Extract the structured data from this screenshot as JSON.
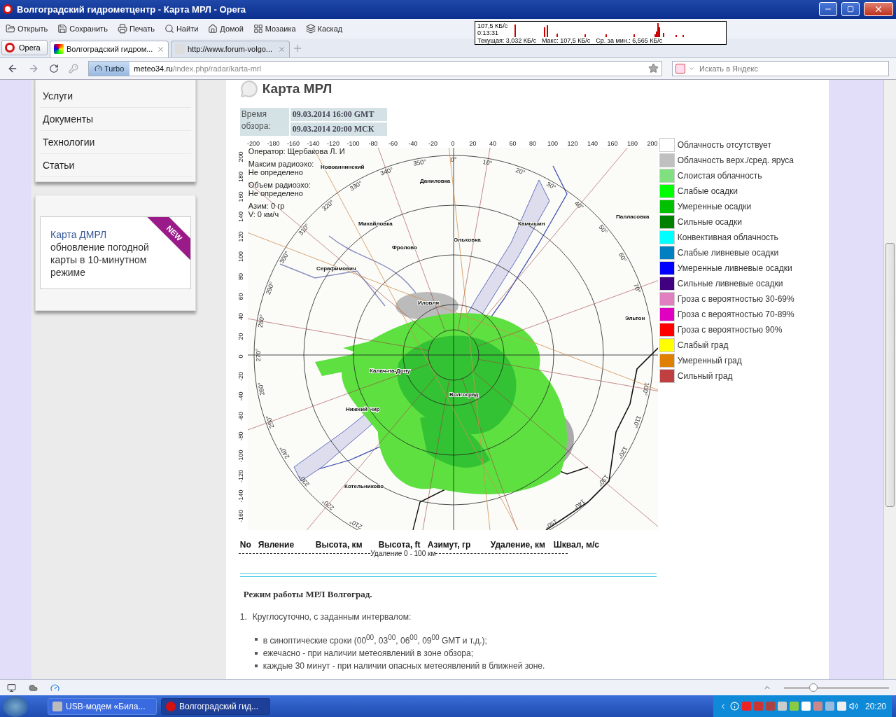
{
  "window": {
    "title": "Волгоградский гидрометцентр - Карта МРЛ - Opera"
  },
  "toolbar": [
    {
      "label": "Открыть"
    },
    {
      "label": "Сохранить"
    },
    {
      "label": "Печать"
    },
    {
      "label": "Найти"
    },
    {
      "label": "Домой"
    },
    {
      "label": "Мозаика"
    },
    {
      "label": "Каскад"
    }
  ],
  "traffic_monitor": {
    "peak": "107,5 КБ/с",
    "elapsed": "0:13:31",
    "current": "Текущая: 3,032 КБ/с",
    "max": "Макс: 107,5 КБ/с",
    "average": "Ср. за мин.: 6,565 КБ/с"
  },
  "menu_button": {
    "label": "Opera"
  },
  "tabs": [
    {
      "title": "Волгоградский гидром...",
      "selected": true
    },
    {
      "title": "http://www.forum-volgo...",
      "selected": false
    }
  ],
  "address_bar": {
    "turbo": "Turbo",
    "domain": "meteo34.ru",
    "path": "/index.php/radar/karta-mrl"
  },
  "search": {
    "placeholder": "Искать в Яндекс"
  },
  "sidebar": {
    "menu": [
      "Услуги",
      "Документы",
      "Технологии",
      "Статьи"
    ],
    "promo": {
      "badge": "NEW",
      "link": "Карта ДМРЛ",
      "text": "обновление погодной карты в 10-минутном режиме"
    }
  },
  "page": {
    "title": "Карта МРЛ",
    "survey_time": {
      "label": "Время обзора:",
      "gmt": "09.03.2014 16:00 GMT",
      "msk": "09.03.2014 20:00 МСК"
    },
    "radar": {
      "x_ticks": [
        "-200",
        "-180",
        "-160",
        "-140",
        "-120",
        "-100",
        "-80",
        "-60",
        "-40",
        "-20",
        "0",
        "20",
        "40",
        "60",
        "80",
        "100",
        "120",
        "140",
        "160",
        "180",
        "200"
      ],
      "y_ticks": [
        "200",
        "180",
        "160",
        "140",
        "120",
        "100",
        "80",
        "60",
        "40",
        "20",
        "0",
        "-20",
        "-40",
        "-60",
        "-80",
        "-100",
        "-120",
        "-140",
        "-160"
      ],
      "info": [
        [
          "Оператор: Щербакова Л. И"
        ],
        [
          "Максим радиоэхо:",
          "Не определено"
        ],
        [
          "Объем радиоэхо:",
          "Не определено"
        ],
        [
          "Азим: 0 гр",
          "V: 0 км/ч"
        ]
      ],
      "places": [
        "Новоаннинский",
        "Даниловка",
        "Михайловка",
        "Фролово",
        "Ольховка",
        "Камышин",
        "Палласовка",
        "Серафимович",
        "Иловля",
        "Эльтон",
        "Калач-на-Дону",
        "Волгоград",
        "Нижний Чир",
        "Котельниково"
      ],
      "bearings": [
        "0°",
        "10°",
        "20°",
        "30°",
        "40°",
        "50°",
        "60°",
        "70°",
        "100°",
        "110°",
        "120°",
        "130°",
        "140°",
        "150°",
        "210°",
        "220°",
        "230°",
        "240°",
        "250°",
        "260°",
        "270°",
        "280°",
        "290°",
        "300°",
        "310°",
        "320°",
        "330°",
        "340°",
        "350°"
      ]
    },
    "legend": [
      {
        "label": "Облачность отсутствует",
        "color": "#ffffff"
      },
      {
        "label": "Облачность верх./сред. яруса",
        "color": "#c0c0c0"
      },
      {
        "label": "Слоистая облачность",
        "color": "#80e080"
      },
      {
        "label": "Слабые осадки",
        "color": "#00ff00"
      },
      {
        "label": "Умеренные осадки",
        "color": "#00c000"
      },
      {
        "label": "Сильные осадки",
        "color": "#008000"
      },
      {
        "label": "Конвективная облачность",
        "color": "#00ffff"
      },
      {
        "label": "Слабые ливневые осадки",
        "color": "#0080c0"
      },
      {
        "label": "Умеренные ливневые осадки",
        "color": "#0000ff"
      },
      {
        "label": "Сильные ливневые осадки",
        "color": "#400080"
      },
      {
        "label": "Гроза с вероятностью 30-69%",
        "color": "#e080c0"
      },
      {
        "label": "Гроза с вероятностью 70-89%",
        "color": "#e000c0"
      },
      {
        "label": "Гроза с вероятностью 90%",
        "color": "#ff0000"
      },
      {
        "label": "Слабый град",
        "color": "#ffff00"
      },
      {
        "label": "Умеренный град",
        "color": "#e08000"
      },
      {
        "label": "Сильный град",
        "color": "#c04040"
      }
    ],
    "table": {
      "columns": [
        "No",
        "Явление",
        "Высота, км",
        "Высота, ft",
        "Азимут, гр",
        "Удаление, км",
        "Шквал, м/с"
      ],
      "section": "Удаление 0 - 100 км"
    },
    "mode": {
      "heading": "Режим работы МРЛ Волгоград.",
      "number": "1.",
      "item": "Круглосуточно, с заданным интервалом:",
      "bullets": [
        "в синоптические сроки (00$^{00}$, 03$^{00}$, 06$^{00}$, 09$^{00}$ GMT и т.д.);",
        "ежечасно - при наличии метеоявлений в зоне обзора;",
        "каждые 30 минут - при наличии опасных метеоявлений в ближней зоне."
      ]
    }
  },
  "status_bar": {
    "zoom": {
      "level": 0.28
    }
  },
  "taskbar": {
    "items": [
      {
        "label": "USB-модем «Била...",
        "selected": false
      },
      {
        "label": "Волгоградский гид...",
        "selected": true
      }
    ],
    "clock": "20:20"
  }
}
